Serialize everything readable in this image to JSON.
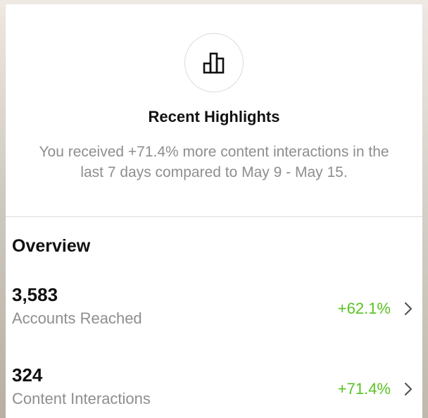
{
  "colors": {
    "accent_positive": "#58c322",
    "text_primary": "#111111",
    "text_secondary": "#8e8e8e",
    "divider": "#dbdbdb"
  },
  "highlight": {
    "icon": "bar-chart-icon",
    "title": "Recent Highlights",
    "body": "You received +71.4% more content interactions in the last 7 days compared to May 9 - May 15."
  },
  "overview": {
    "title": "Overview",
    "metrics": [
      {
        "value": "3,583",
        "label": "Accounts Reached",
        "change": "+62.1%",
        "icon": "chevron-right-icon"
      },
      {
        "value": "324",
        "label": "Content Interactions",
        "change": "+71.4%",
        "icon": "chevron-right-icon"
      }
    ]
  }
}
